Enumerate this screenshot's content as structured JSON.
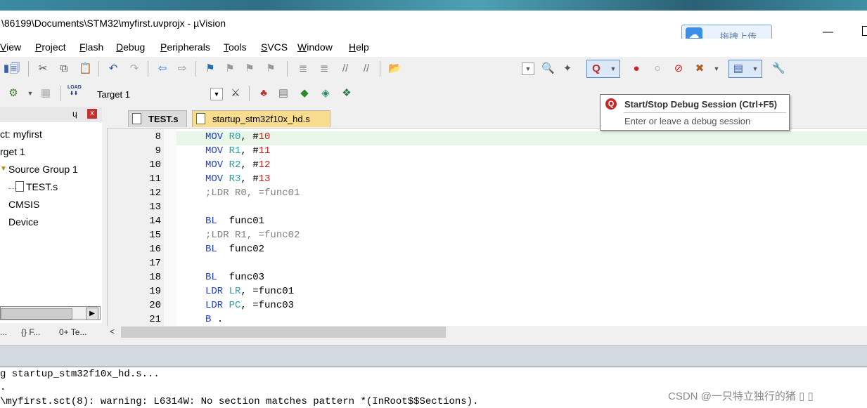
{
  "window": {
    "title": "\\86199\\Documents\\STM32\\myfirst.uvprojx - µVision",
    "upload_button": "拖拽上传",
    "minimize_label": "—"
  },
  "menu": [
    {
      "label": "View",
      "u": "V",
      "rest": "iew"
    },
    {
      "label": "Project",
      "u": "P",
      "rest": "roject"
    },
    {
      "label": "Flash",
      "u": "F",
      "rest": "lash",
      "prefix": ""
    },
    {
      "label": "Debug",
      "u": "D",
      "rest": "ebug"
    },
    {
      "label": "Peripherals",
      "u": "P",
      "rest": "eripherals"
    },
    {
      "label": "Tools",
      "u": "T",
      "rest": "ools"
    },
    {
      "label": "SVCS",
      "u": "S",
      "rest": "VCS"
    },
    {
      "label": "Window",
      "u": "W",
      "rest": "indow"
    },
    {
      "label": "Help",
      "u": "H",
      "rest": "elp"
    }
  ],
  "toolbar": {
    "target": "Target 1",
    "load_label": "LOAD"
  },
  "project": {
    "pin": "ɥ",
    "close": "x",
    "tree": [
      "ct: myfirst",
      "rget 1",
      "Source Group 1",
      "TEST.s",
      "CMSIS",
      "Device"
    ],
    "tabs": [
      "...",
      "{} F...",
      "0+ Te..."
    ]
  },
  "editor": {
    "tabs": [
      "TEST.s",
      "startup_stm32f10x_hd.s"
    ],
    "lines": [
      {
        "n": "8",
        "parts": [
          [
            "kw",
            "MOV "
          ],
          [
            "rg",
            "R0"
          ],
          [
            "id",
            ", #"
          ],
          [
            "nm",
            "10"
          ]
        ]
      },
      {
        "n": "9",
        "parts": [
          [
            "kw",
            "MOV "
          ],
          [
            "rg",
            "R1"
          ],
          [
            "id",
            ", #"
          ],
          [
            "nm",
            "11"
          ]
        ]
      },
      {
        "n": "10",
        "parts": [
          [
            "kw",
            "MOV "
          ],
          [
            "rg",
            "R2"
          ],
          [
            "id",
            ", #"
          ],
          [
            "nm",
            "12"
          ]
        ]
      },
      {
        "n": "11",
        "parts": [
          [
            "kw",
            "MOV "
          ],
          [
            "rg",
            "R3"
          ],
          [
            "id",
            ", #"
          ],
          [
            "nm",
            "13"
          ]
        ]
      },
      {
        "n": "12",
        "parts": [
          [
            "cm",
            ";LDR R0, =func01"
          ]
        ]
      },
      {
        "n": "13",
        "parts": []
      },
      {
        "n": "14",
        "parts": [
          [
            "kw",
            "BL"
          ],
          [
            "id",
            "  func01"
          ]
        ]
      },
      {
        "n": "15",
        "parts": [
          [
            "cm",
            ";LDR R1, =func02"
          ]
        ]
      },
      {
        "n": "16",
        "parts": [
          [
            "kw",
            "BL"
          ],
          [
            "id",
            "  func02"
          ]
        ]
      },
      {
        "n": "17",
        "parts": []
      },
      {
        "n": "18",
        "parts": [
          [
            "kw",
            "BL"
          ],
          [
            "id",
            "  func03"
          ]
        ]
      },
      {
        "n": "19",
        "parts": [
          [
            "kw",
            "LDR "
          ],
          [
            "rg",
            "LR"
          ],
          [
            "id",
            ", =func01"
          ]
        ]
      },
      {
        "n": "20",
        "parts": [
          [
            "kw",
            "LDR "
          ],
          [
            "rg",
            "PC"
          ],
          [
            "id",
            ", =func03"
          ]
        ]
      },
      {
        "n": "21",
        "parts": [
          [
            "kw",
            "B"
          ],
          [
            "id",
            " ."
          ]
        ]
      }
    ]
  },
  "build": [
    "g startup_stm32f10x_hd.s...",
    ".",
    "\\myfirst.sct(8): warning: L6314W: No section matches pattern *(InRoot$$Sections)."
  ],
  "watermark": "CSDN @一只特立独行的猪 ▯ ▯",
  "tooltip": {
    "title": "Start/Stop Debug Session (Ctrl+F5)",
    "desc": "Enter or leave a debug session"
  },
  "colors": {
    "keyword": "#1d3fd3",
    "register": "#28a0a6",
    "number": "#c41e1e",
    "comment": "#7f7f7f",
    "active_tab": "#f9dd8e"
  }
}
